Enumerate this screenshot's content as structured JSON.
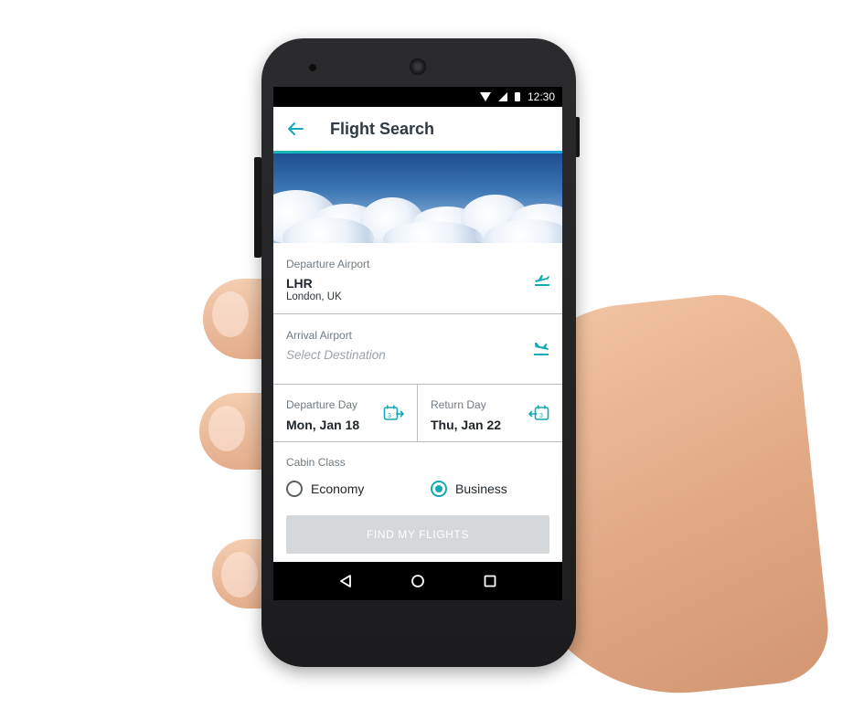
{
  "status_bar": {
    "time": "12:30"
  },
  "toolbar": {
    "title": "Flight Search",
    "back_icon": "arrow-left-icon"
  },
  "departure": {
    "label": "Departure Airport",
    "code": "LHR",
    "city": "London, UK",
    "icon": "flight-takeoff-icon"
  },
  "arrival": {
    "label": "Arrival Airport",
    "placeholder": "Select Destination",
    "icon": "flight-land-icon"
  },
  "dates": {
    "departure_label": "Departure Day",
    "departure_value": "Mon, Jan 18",
    "departure_icon_day": "3",
    "return_label": "Return Day",
    "return_value": "Thu, Jan 22",
    "return_icon_day": "3"
  },
  "cabin": {
    "label": "Cabin Class",
    "options": [
      {
        "label": "Economy",
        "selected": false
      },
      {
        "label": "Business",
        "selected": true
      }
    ]
  },
  "find_button": {
    "label": "FIND MY FLIGHTS",
    "enabled": false
  },
  "colors": {
    "accent": "#13a9b6",
    "accent_gradient_end": "#21a1dd",
    "button_disabled": "#d4d8db"
  }
}
